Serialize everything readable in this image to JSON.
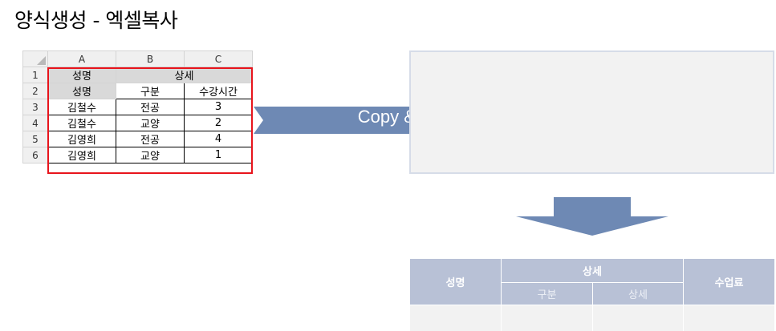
{
  "page": {
    "title": "양식생성 - 엑셀복사"
  },
  "sheet": {
    "columns": [
      "A",
      "B",
      "C"
    ],
    "row_numbers": [
      "1",
      "2",
      "3",
      "4",
      "5",
      "6"
    ],
    "header1": {
      "name": "성명",
      "detail": "상세"
    },
    "header2": {
      "name": "성명",
      "category": "구분",
      "hours": "수강시간"
    },
    "rows": [
      {
        "name": "김철수",
        "category": "전공",
        "hours": "3"
      },
      {
        "name": "김철수",
        "category": "교양",
        "hours": "2"
      },
      {
        "name": "김영희",
        "category": "전공",
        "hours": "4"
      },
      {
        "name": "김영희",
        "category": "교양",
        "hours": "1"
      }
    ]
  },
  "arrow": {
    "label": "Copy & Paste",
    "color": "#6e89b4"
  },
  "result": {
    "header_name": "성명",
    "header_detail": "상세",
    "sub_category": "구분",
    "sub_detail": "상세",
    "header_fee": "수업료"
  },
  "colors": {
    "selection": "#e8141c",
    "result_header": "#b8c1d6",
    "paste_bg": "#f2f2f2"
  }
}
